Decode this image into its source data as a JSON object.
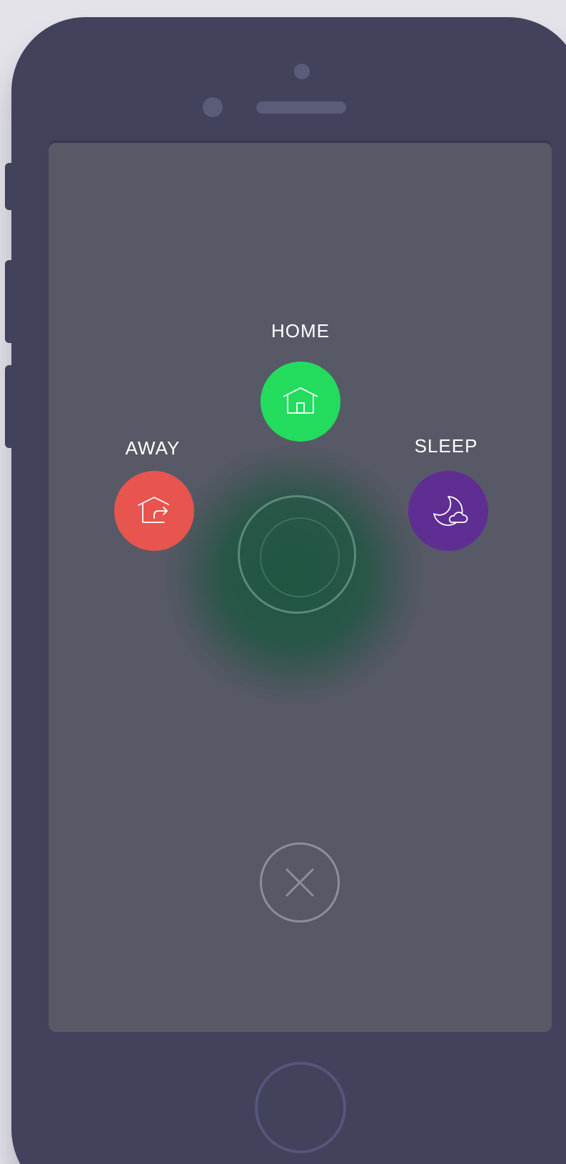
{
  "modes": {
    "home": {
      "label": "HOME",
      "color": "#23dc5e",
      "icon": "house-icon"
    },
    "away": {
      "label": "AWAY",
      "color": "#e8544e",
      "icon": "house-exit-icon"
    },
    "sleep": {
      "label": "SLEEP",
      "color": "#5f2e92",
      "icon": "moon-cloud-icon"
    }
  },
  "controls": {
    "close_icon": "close-icon",
    "center_icon": "ring-icon"
  }
}
